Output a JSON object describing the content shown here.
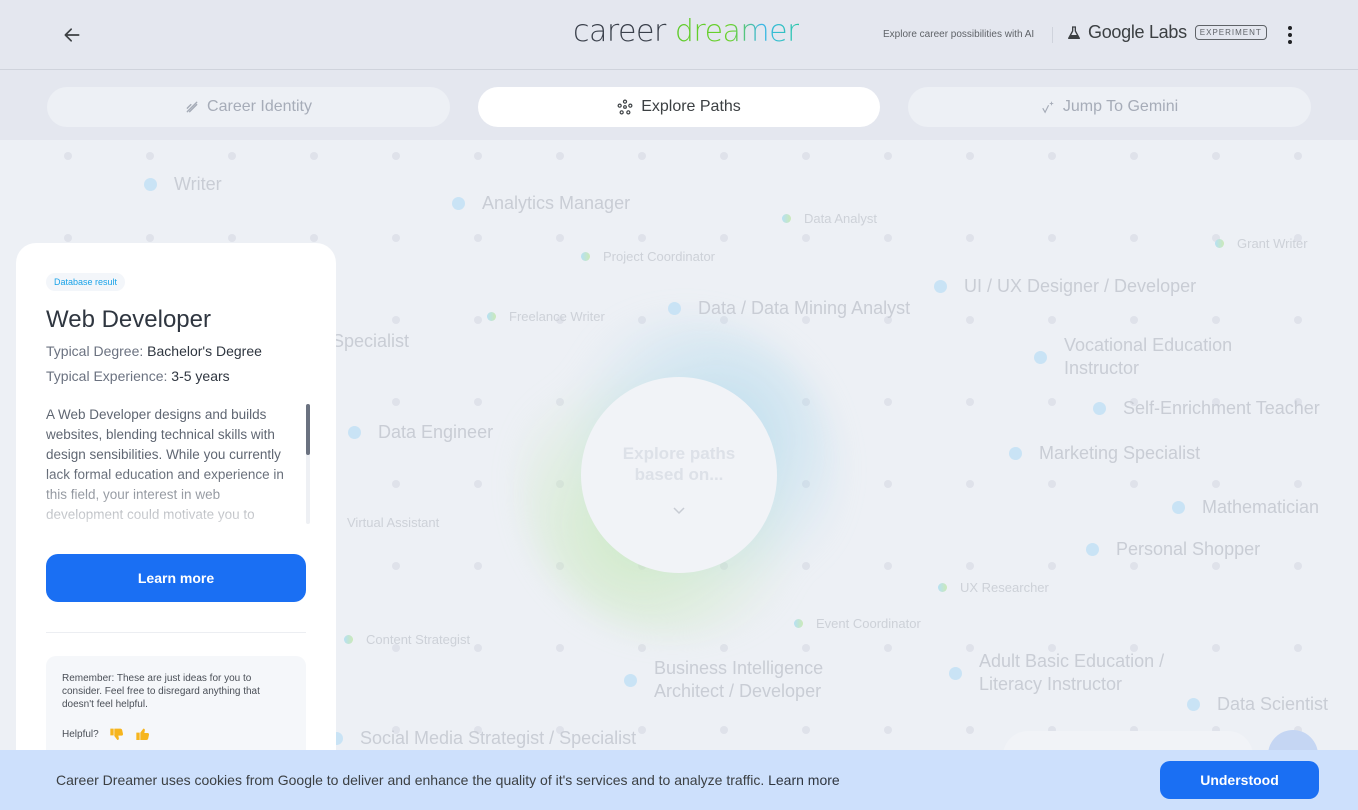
{
  "header": {
    "back_icon": "arrow-left-icon",
    "logo_word1": "career",
    "logo_word2": "dreamer",
    "tagline": "Explore career possibilities with AI",
    "labs_icon": "flask-icon",
    "labs_label": "Google Labs",
    "experiment_badge": "EXPERIMENT",
    "menu_icon": "more-vert-icon"
  },
  "tabs": [
    {
      "label": "Career Identity",
      "icon": "pencil-sparkle-icon",
      "active": false
    },
    {
      "label": "Explore Paths",
      "icon": "network-nodes-icon",
      "active": true
    },
    {
      "label": "Jump To Gemini",
      "icon": "sparkle-icon",
      "active": false
    }
  ],
  "map": {
    "center_prompt": "Explore paths based on...",
    "center_icon": "chevron-down-icon",
    "nodes": [
      {
        "label": "Writer",
        "size": "big"
      },
      {
        "label": "Analytics Manager",
        "size": "big"
      },
      {
        "label": "Data Analyst",
        "size": "small"
      },
      {
        "label": "Grant Writer",
        "size": "small"
      },
      {
        "label": "Project Coordinator",
        "size": "small"
      },
      {
        "label": "UI / UX Designer / Developer",
        "size": "big"
      },
      {
        "label": "Freelance Writer",
        "size": "small"
      },
      {
        "label": "Data / Data Mining Analyst",
        "size": "big"
      },
      {
        "label": "ices Specialist",
        "size": "big"
      },
      {
        "label": "Vocational Education Instructor",
        "size": "big"
      },
      {
        "label": "Self-Enrichment Teacher",
        "size": "big"
      },
      {
        "label": "Data Engineer",
        "size": "big"
      },
      {
        "label": "Marketing Specialist",
        "size": "big"
      },
      {
        "label": "Mathematician",
        "size": "big"
      },
      {
        "label": "Virtual Assistant",
        "size": "plain"
      },
      {
        "label": "Personal Shopper",
        "size": "big"
      },
      {
        "label": "UX Researcher",
        "size": "small"
      },
      {
        "label": "Event Coordinator",
        "size": "small"
      },
      {
        "label": "Content Strategist",
        "size": "small"
      },
      {
        "label": "Business Intelligence Architect / Developer",
        "size": "big"
      },
      {
        "label": "Adult Basic Education / Literacy Instructor",
        "size": "big"
      },
      {
        "label": "Data Scientist",
        "size": "big"
      },
      {
        "label": "Social Media Strategist / Specialist",
        "size": "big"
      }
    ]
  },
  "card": {
    "badge": "Database result",
    "title": "Web Developer",
    "degree_label": "Typical Degree:",
    "degree_value": "Bachelor's Degree",
    "experience_label": "Typical Experience:",
    "experience_value": "3-5 years",
    "description": "A Web Developer designs and builds websites, blending technical skills with design sensibilities. While you currently lack formal education and experience in this field, your interest in web development could motivate you to",
    "scroll_fraction": 0.3,
    "learn_more_label": "Learn more",
    "note": "Remember: These are just ideas for you to consider. Feel free to disregard anything that doesn't feel helpful.",
    "helpful_label": "Helpful?",
    "thumbs_down_icon": "thumbs-down-icon",
    "thumbs_up_icon": "thumbs-up-icon"
  },
  "cookie": {
    "text": "Career Dreamer uses cookies from Google to deliver and enhance the quality of it's services and to analyze traffic.",
    "link": "Learn more",
    "button": "Understood"
  },
  "colors": {
    "accent": "#1a6ff3",
    "background": "#e4e7ef",
    "cookie_bar": "#cde0fc",
    "badge_text": "#1aa3e8"
  }
}
